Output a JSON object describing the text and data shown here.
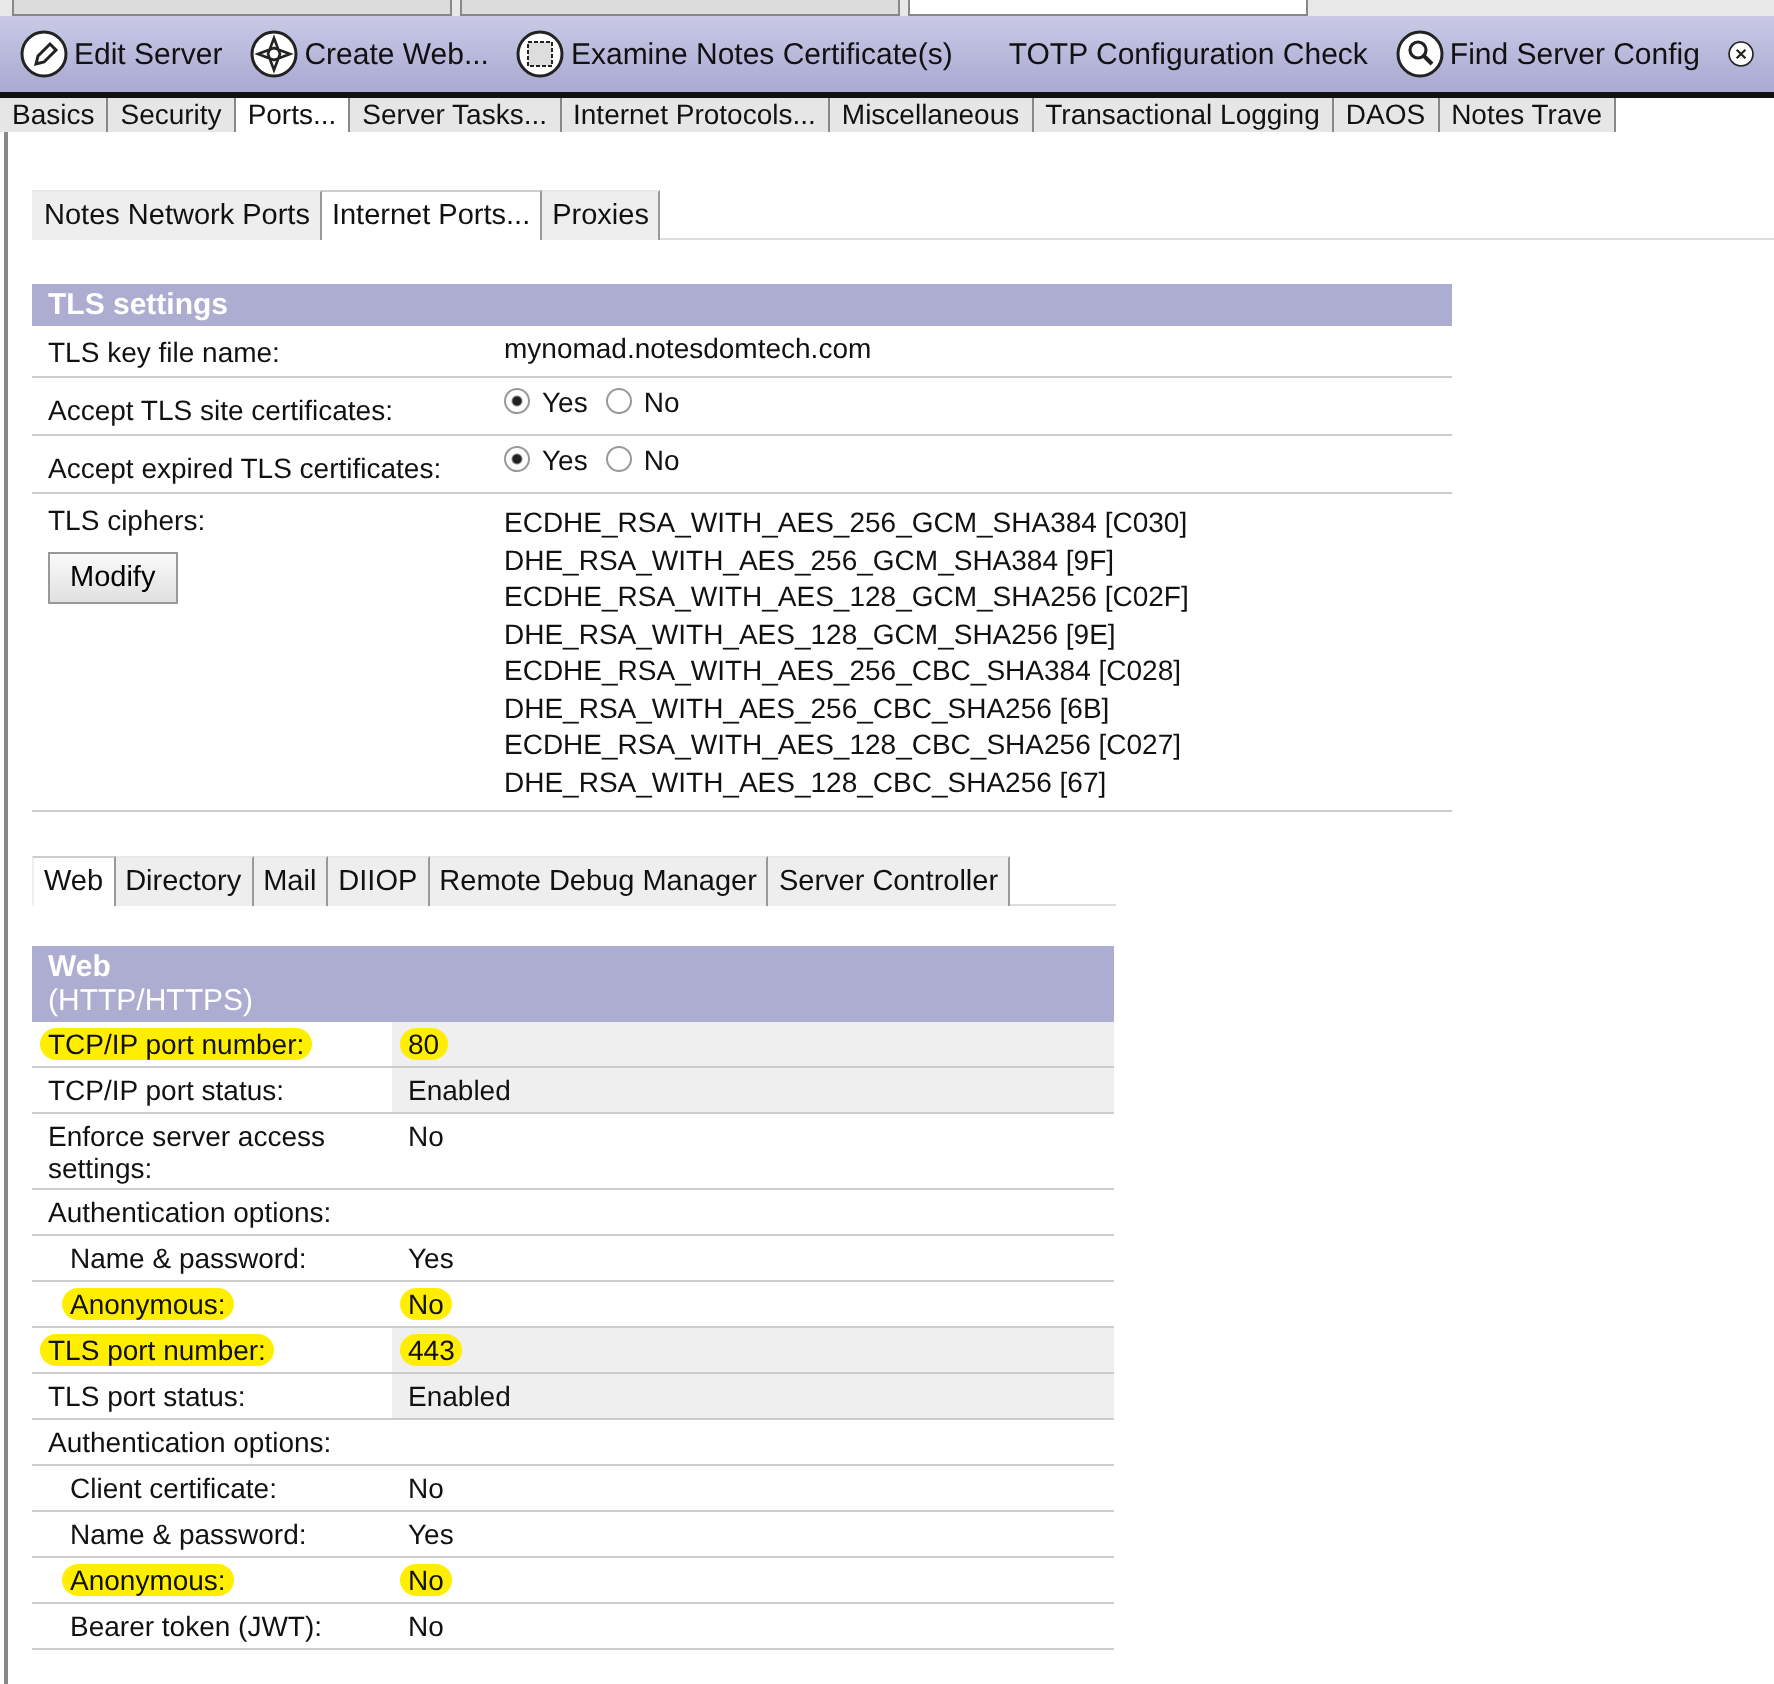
{
  "window_tabs": [
    {
      "selected": false
    },
    {
      "selected": false
    },
    {
      "selected": true
    }
  ],
  "toolbar": [
    {
      "label": "Edit Server"
    },
    {
      "label": "Create Web..."
    },
    {
      "label": "Examine Notes Certificate(s)"
    },
    {
      "label": "TOTP Configuration Check"
    },
    {
      "label": "Find Server Config"
    }
  ],
  "main_tabs": [
    {
      "label": "Basics",
      "selected": false
    },
    {
      "label": "Security",
      "selected": false
    },
    {
      "label": "Ports...",
      "selected": true
    },
    {
      "label": "Server Tasks...",
      "selected": false
    },
    {
      "label": "Internet Protocols...",
      "selected": false
    },
    {
      "label": "Miscellaneous",
      "selected": false
    },
    {
      "label": "Transactional Logging",
      "selected": false
    },
    {
      "label": "DAOS",
      "selected": false
    },
    {
      "label": "Notes Trave",
      "selected": false
    }
  ],
  "port_tabs": [
    {
      "label": "Notes Network Ports",
      "selected": false
    },
    {
      "label": "Internet Ports...",
      "selected": true
    },
    {
      "label": "Proxies",
      "selected": false
    }
  ],
  "tls_settings": {
    "title": "TLS settings",
    "rows": [
      {
        "kind": "text",
        "label": "TLS key file name:",
        "value": "mynomad.notesdomtech.com"
      },
      {
        "kind": "radio",
        "label": "Accept TLS site certificates:",
        "options": [
          {
            "label": "Yes",
            "selected": true
          },
          {
            "label": "No",
            "selected": false
          }
        ]
      },
      {
        "kind": "radio",
        "label": "Accept expired TLS certificates:",
        "options": [
          {
            "label": "Yes",
            "selected": true
          },
          {
            "label": "No",
            "selected": false
          }
        ]
      },
      {
        "kind": "list",
        "label": "TLS ciphers:",
        "button": "Modify",
        "values": [
          "ECDHE_RSA_WITH_AES_256_GCM_SHA384 [C030]",
          "DHE_RSA_WITH_AES_256_GCM_SHA384 [9F]",
          "ECDHE_RSA_WITH_AES_128_GCM_SHA256 [C02F]",
          "DHE_RSA_WITH_AES_128_GCM_SHA256 [9E]",
          "ECDHE_RSA_WITH_AES_256_CBC_SHA384 [C028]",
          "DHE_RSA_WITH_AES_256_CBC_SHA256 [6B]",
          "ECDHE_RSA_WITH_AES_128_CBC_SHA256 [C027]",
          "DHE_RSA_WITH_AES_128_CBC_SHA256 [67]"
        ]
      }
    ]
  },
  "protocol_tabs": [
    {
      "label": "Web",
      "selected": true
    },
    {
      "label": "Directory",
      "selected": false
    },
    {
      "label": "Mail",
      "selected": false
    },
    {
      "label": "DIIOP",
      "selected": false
    },
    {
      "label": "Remote Debug Manager",
      "selected": false
    },
    {
      "label": "Server Controller",
      "selected": false
    }
  ],
  "web": {
    "title": "Web",
    "subtitle": "(HTTP/HTTPS)",
    "rows": [
      {
        "label": "TCP/IP port number:",
        "value": "80",
        "shaded": true,
        "highlighted": true
      },
      {
        "label": "TCP/IP port status:",
        "value": "Enabled",
        "shaded": true,
        "highlighted": false
      },
      {
        "label": "Enforce server access settings:",
        "value": "No",
        "shaded": false,
        "highlighted": false
      },
      {
        "label": "Authentication options:",
        "shaded": false,
        "highlighted": false,
        "children": [
          {
            "label": "Name & password:",
            "value": "Yes",
            "shaded": false,
            "highlighted": false
          },
          {
            "label": "Anonymous:",
            "value": "No",
            "shaded": false,
            "highlighted": true
          }
        ]
      },
      {
        "label": "TLS port number:",
        "value": "443",
        "shaded": true,
        "highlighted": true
      },
      {
        "label": "TLS port status:",
        "value": "Enabled",
        "shaded": true,
        "highlighted": false
      },
      {
        "label": "Authentication options:",
        "shaded": false,
        "highlighted": false,
        "children": [
          {
            "label": "Client certificate:",
            "value": "No",
            "shaded": false,
            "highlighted": false
          },
          {
            "label": "Name & password:",
            "value": "Yes",
            "shaded": false,
            "highlighted": false
          },
          {
            "label": "Anonymous:",
            "value": "No",
            "shaded": false,
            "highlighted": true
          },
          {
            "label": "Bearer token (JWT):",
            "value": "No",
            "shaded": false,
            "highlighted": false
          }
        ]
      }
    ]
  }
}
